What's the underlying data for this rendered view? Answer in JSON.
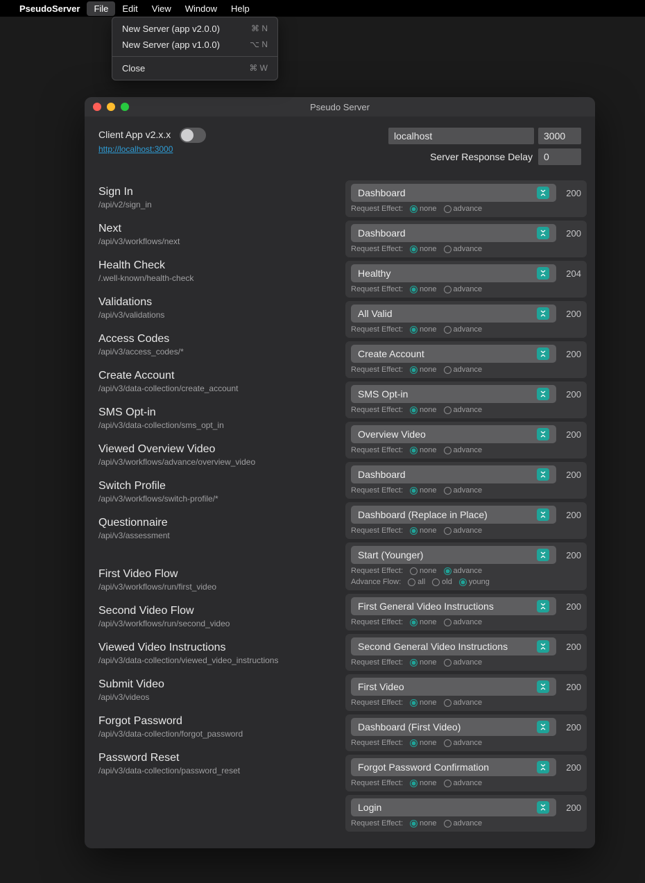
{
  "menubar": {
    "app": "PseudoServer",
    "items": [
      "File",
      "Edit",
      "View",
      "Window",
      "Help"
    ],
    "active_index": 0
  },
  "dropdown": {
    "items": [
      {
        "label": "New Server (app v2.0.0)",
        "shortcut": "⌘ N"
      },
      {
        "label": "New Server (app v1.0.0)",
        "shortcut": "⌥ N"
      }
    ],
    "close": {
      "label": "Close",
      "shortcut": "⌘ W"
    }
  },
  "window": {
    "title": "Pseudo Server",
    "client_label": "Client App v2.x.x",
    "client_link": "http://localhost:3000",
    "host": "localhost",
    "port": "3000",
    "delay_label": "Server Response Delay",
    "delay_value": "0"
  },
  "labels": {
    "request_effect": "Request Effect:",
    "advance_flow": "Advance Flow:",
    "none": "none",
    "advance": "advance",
    "all": "all",
    "old": "old",
    "young": "young"
  },
  "routes": [
    {
      "title": "Sign In",
      "path": "/api/v2/sign_in"
    },
    {
      "title": "Next",
      "path": "/api/v3/workflows/next"
    },
    {
      "title": "Health Check",
      "path": "/.well-known/health-check"
    },
    {
      "title": "Validations",
      "path": "/api/v3/validations"
    },
    {
      "title": "Access Codes",
      "path": "/api/v3/access_codes/*"
    },
    {
      "title": "Create Account",
      "path": "/api/v3/data-collection/create_account"
    },
    {
      "title": "SMS Opt-in",
      "path": "/api/v3/data-collection/sms_opt_in"
    },
    {
      "title": "Viewed Overview Video",
      "path": "/api/v3/workflows/advance/overview_video"
    },
    {
      "title": "Switch Profile",
      "path": "/api/v3/workflows/switch-profile/*"
    },
    {
      "title": "Questionnaire",
      "path": "/api/v3/assessment",
      "gap": true
    },
    {
      "title": "First Video Flow",
      "path": "/api/v3/workflows/run/first_video"
    },
    {
      "title": "Second Video Flow",
      "path": "/api/v3/workflows/run/second_video"
    },
    {
      "title": "Viewed Video Instructions",
      "path": "/api/v3/data-collection/viewed_video_instructions"
    },
    {
      "title": "Submit Video",
      "path": "/api/v3/videos"
    },
    {
      "title": "Forgot Password",
      "path": "/api/v3/data-collection/forgot_password"
    },
    {
      "title": "Password Reset",
      "path": "/api/v3/data-collection/password_reset"
    }
  ],
  "responses": [
    {
      "sel": "Dashboard",
      "status": "200",
      "effect": "none"
    },
    {
      "sel": "Dashboard",
      "status": "200",
      "effect": "none"
    },
    {
      "sel": "Healthy",
      "status": "204",
      "effect": "none"
    },
    {
      "sel": "All Valid",
      "status": "200",
      "effect": "none"
    },
    {
      "sel": "Create Account",
      "status": "200",
      "effect": "none"
    },
    {
      "sel": "SMS Opt-in",
      "status": "200",
      "effect": "none"
    },
    {
      "sel": "Overview Video",
      "status": "200",
      "effect": "none"
    },
    {
      "sel": "Dashboard",
      "status": "200",
      "effect": "none"
    },
    {
      "sel": "Dashboard (Replace in Place)",
      "status": "200",
      "effect": "none"
    },
    {
      "sel": "Start (Younger)",
      "status": "200",
      "effect": "advance",
      "flow": "young"
    },
    {
      "sel": "First General Video Instructions",
      "status": "200",
      "effect": "none"
    },
    {
      "sel": "Second General Video Instructions",
      "status": "200",
      "effect": "none"
    },
    {
      "sel": "First Video",
      "status": "200",
      "effect": "none"
    },
    {
      "sel": "Dashboard (First Video)",
      "status": "200",
      "effect": "none"
    },
    {
      "sel": "Forgot Password Confirmation",
      "status": "200",
      "effect": "none"
    },
    {
      "sel": "Login",
      "status": "200",
      "effect": "none"
    }
  ]
}
